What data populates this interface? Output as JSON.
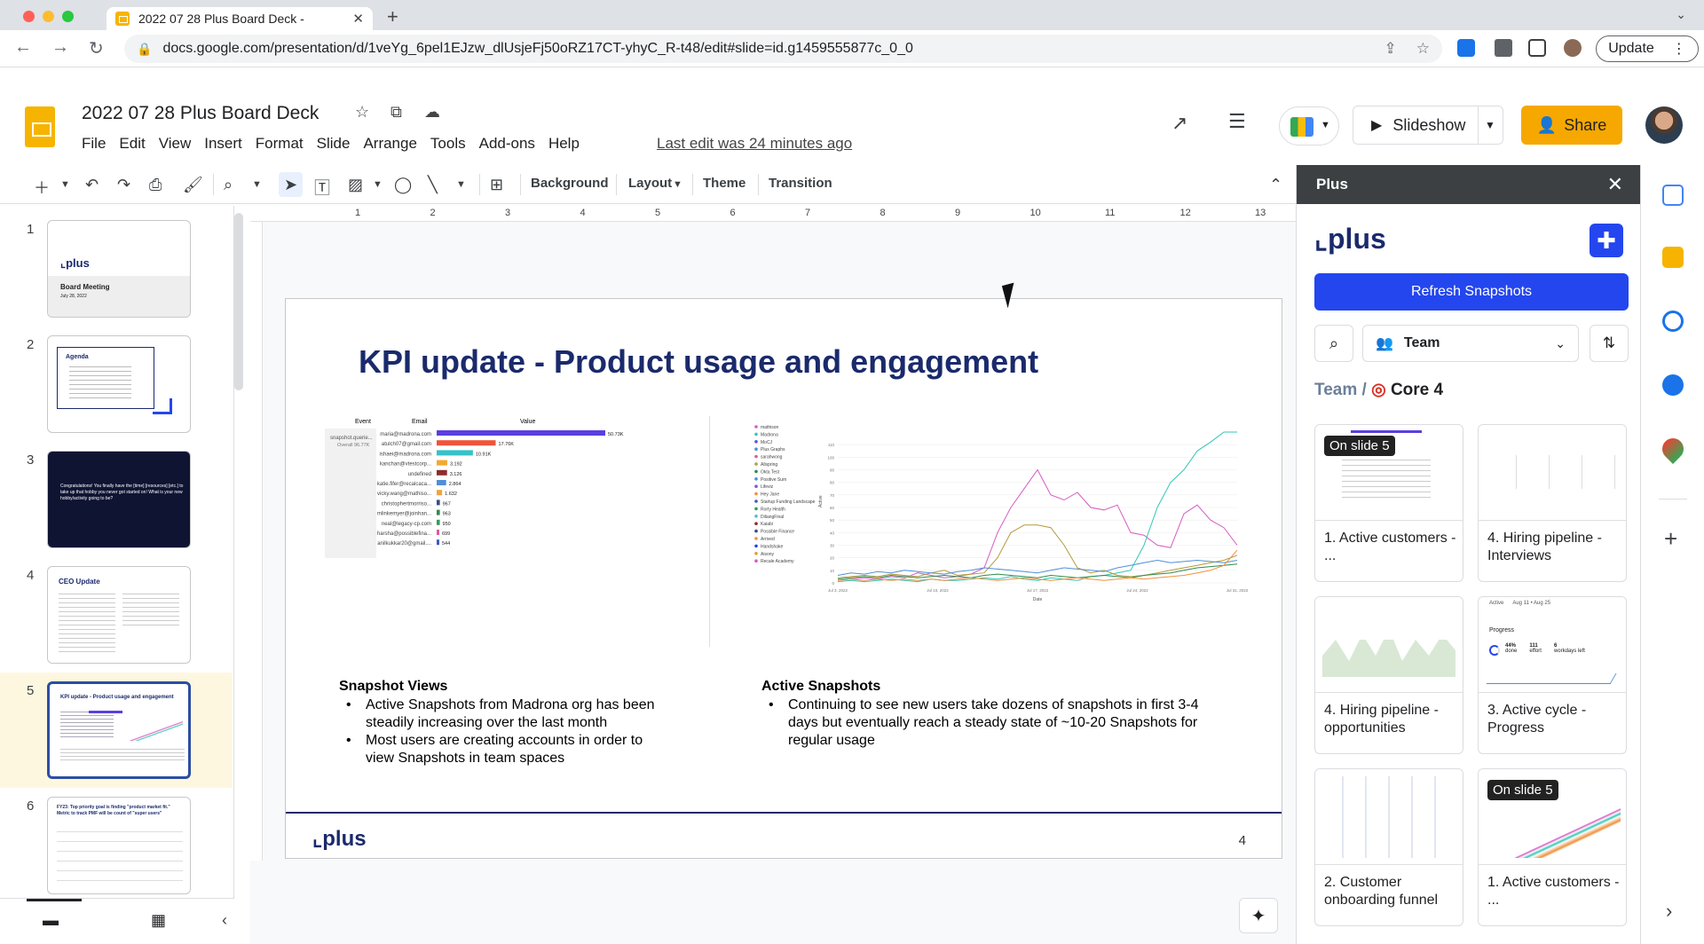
{
  "browser": {
    "tab_title": "2022 07 28 Plus Board Deck -",
    "url": "docs.google.com/presentation/d/1veYg_6pel1EJzw_dlUsjeFj50oRZ17CT-yhyC_R-t48/edit#slide=id.g1459555877c_0_0",
    "update_label": "Update"
  },
  "doc": {
    "title": "2022 07 28 Plus Board Deck",
    "menus": [
      "File",
      "Edit",
      "View",
      "Insert",
      "Format",
      "Slide",
      "Arrange",
      "Tools",
      "Add-ons",
      "Help"
    ],
    "last_edit": "Last edit was 24 minutes ago",
    "slideshow_label": "Slideshow",
    "share_label": "Share"
  },
  "edit_toolbar": {
    "background": "Background",
    "layout": "Layout",
    "theme": "Theme",
    "transition": "Transition"
  },
  "ruler_ticks": [
    "1",
    "2",
    "3",
    "4",
    "5",
    "6",
    "7",
    "8",
    "9",
    "10",
    "11",
    "12",
    "13"
  ],
  "filmstrip": [
    {
      "num": "1",
      "title": "Board Meeting",
      "sub": "July 28, 2022"
    },
    {
      "num": "2",
      "title": "Agenda"
    },
    {
      "num": "3",
      "title": "Congratulations! You finally have the [time] [resources] [etc.] to take up that hobby you never got started on! What is your new hobby/activity going to be?"
    },
    {
      "num": "4",
      "title": "CEO Update"
    },
    {
      "num": "5",
      "title": "KPI update - Product usage and engagement"
    },
    {
      "num": "6",
      "title": "FY23: Top priority goal is finding \"product market fit.\" Metric to track PMF will be count of \"super users\""
    }
  ],
  "slide": {
    "title": "KPI update - Product usage and engagement",
    "left_heading": "Snapshot Views",
    "left_bullets": [
      "Active Snapshots from Madrona org has been steadily increasing over the last month",
      "Most users are creating accounts in order to view Snapshots in team spaces"
    ],
    "right_heading": "Active Snapshots",
    "right_bullets": [
      "Continuing to see new users take dozens of snapshots in first 3-4 days but eventually reach a steady state of ~10-20 Snapshots for regular usage"
    ],
    "logo": "plus",
    "page_number": "4"
  },
  "chart_data": [
    {
      "type": "bar",
      "columns": [
        "Event",
        "Email",
        "Value"
      ],
      "event_label": "snapshot.querie...",
      "event_sub": "Overall 96.77K",
      "categories": [
        "maria@madrona.com",
        "atulch07@gmail.com",
        "ishaei@madrona.com",
        "kanchan@vtestcorp...",
        "undefined",
        "katie.fifer@recalcaca...",
        "vicky.wang@mathiso...",
        "christophertmorriso...",
        "mlinkemyer@joinhan...",
        "neal@legacy-cp.com",
        "harsha@possiblefina...",
        "anilkukkar20@gmail...."
      ],
      "values": [
        50.73,
        17.76,
        10.91,
        3.192,
        3.126,
        2.864,
        1.632,
        0.967,
        0.963,
        0.95,
        0.699,
        0.544
      ],
      "value_labels": [
        "50.73K",
        "17.76K",
        "10.91K",
        "3.192",
        "3.126",
        "2.864",
        "1.632",
        "967",
        "963",
        "950",
        "699",
        "544"
      ],
      "colors": [
        "#5b3ee0",
        "#f0543a",
        "#35c2c9",
        "#f4a92b",
        "#8d2c2c",
        "#4e8fd6",
        "#f2a33a",
        "#3b4a8a",
        "#2e8b4a",
        "#2e9c5e",
        "#e05a9d",
        "#3a5bbf"
      ]
    },
    {
      "type": "line",
      "ylabel": "Active",
      "xlabel": "Date",
      "x_ticks": [
        "Jul 3, 2022",
        "Jul 10, 2022",
        "Jul 17, 2022",
        "Jul 24, 2022",
        "Jul 31, 2022"
      ],
      "y_ticks": [
        "0",
        "10",
        "20",
        "30",
        "40",
        "50",
        "60",
        "70",
        "80",
        "90",
        "100",
        "110"
      ],
      "legend": [
        "mathison",
        "Madrona",
        "MoCJ",
        "Plus Graphs",
        "sarahwong",
        "Allspring",
        "Okta Test",
        "Positive Sum",
        "Lifeviz",
        "Hey Jane",
        "Startup Funding Landscape",
        "Rorty Health",
        "DiliangFinal",
        "Kaiabi",
        "Possible Finance",
        "Arrived",
        "Handshake",
        "Aisony",
        "Recale Academy"
      ],
      "series": [
        {
          "name": "mathison",
          "color": "#d65bc2",
          "values": [
            2,
            3,
            4,
            3,
            5,
            4,
            8,
            6,
            4,
            5,
            7,
            12,
            40,
            60,
            75,
            90,
            70,
            66,
            72,
            60,
            58,
            62,
            40,
            38,
            30,
            28,
            55,
            62,
            50,
            44,
            30
          ]
        },
        {
          "name": "Madrona",
          "color": "#35c6b5",
          "values": [
            1,
            2,
            1,
            2,
            3,
            2,
            1,
            3,
            2,
            2,
            3,
            4,
            3,
            5,
            3,
            2,
            4,
            3,
            2,
            5,
            6,
            8,
            10,
            30,
            60,
            80,
            90,
            105,
            112,
            120,
            128
          ]
        },
        {
          "name": "Allspring",
          "color": "#b59a3a",
          "values": [
            4,
            5,
            6,
            5,
            7,
            6,
            5,
            8,
            10,
            6,
            7,
            8,
            20,
            40,
            46,
            46,
            44,
            30,
            12,
            8,
            10,
            6,
            5,
            6,
            8,
            10,
            12,
            14,
            16,
            18,
            22
          ]
        },
        {
          "name": "Positive Sum",
          "color": "#4e8fd6",
          "values": [
            6,
            8,
            7,
            9,
            8,
            10,
            9,
            8,
            7,
            9,
            10,
            12,
            11,
            10,
            9,
            8,
            10,
            12,
            11,
            10,
            9,
            12,
            14,
            16,
            18,
            16,
            17,
            18,
            17,
            16,
            18
          ]
        },
        {
          "name": "Okta Test",
          "color": "#2e8b4a",
          "values": [
            3,
            4,
            5,
            4,
            6,
            5,
            4,
            5,
            6,
            5,
            4,
            6,
            7,
            6,
            5,
            4,
            6,
            5,
            4,
            5,
            6,
            5,
            4,
            6,
            7,
            8,
            10,
            12,
            13,
            14,
            15
          ]
        },
        {
          "name": "Arrived",
          "color": "#f0903a",
          "values": [
            2,
            3,
            2,
            3,
            2,
            3,
            2,
            3,
            2,
            3,
            4,
            3,
            2,
            3,
            4,
            3,
            2,
            3,
            4,
            3,
            2,
            3,
            4,
            3,
            4,
            5,
            6,
            8,
            10,
            14,
            26
          ]
        }
      ]
    }
  ],
  "panel": {
    "header": "Plus",
    "logo": "plus",
    "refresh_label": "Refresh Snapshots",
    "team_label": "Team",
    "crumb_root": "Team",
    "crumb_sep": "/",
    "crumb_leaf": "Core 4",
    "cards": [
      {
        "label": "1. Active customers - ...",
        "badge": "On slide 5"
      },
      {
        "label": "4. Hiring pipeline - Interviews",
        "badge": ""
      },
      {
        "label": "4. Hiring pipeline - opportunities",
        "badge": ""
      },
      {
        "label": "3. Active cycle - Progress",
        "badge": ""
      },
      {
        "label": "2. Customer onboarding funnel",
        "badge": ""
      },
      {
        "label": "1. Active customers - ...",
        "badge": "On slide 5"
      }
    ],
    "card3_img": {
      "left": "Active",
      "mid": "Aug 11 • Aug 25",
      "title": "Progress",
      "p1": "44%",
      "p1s": "done",
      "p2": "111",
      "p2s": "effort",
      "p3": "6",
      "p3s": "workdays left"
    }
  },
  "colors": {
    "accent": "#2446ee",
    "brand": "#1a2a6c",
    "share": "#f6a800"
  }
}
